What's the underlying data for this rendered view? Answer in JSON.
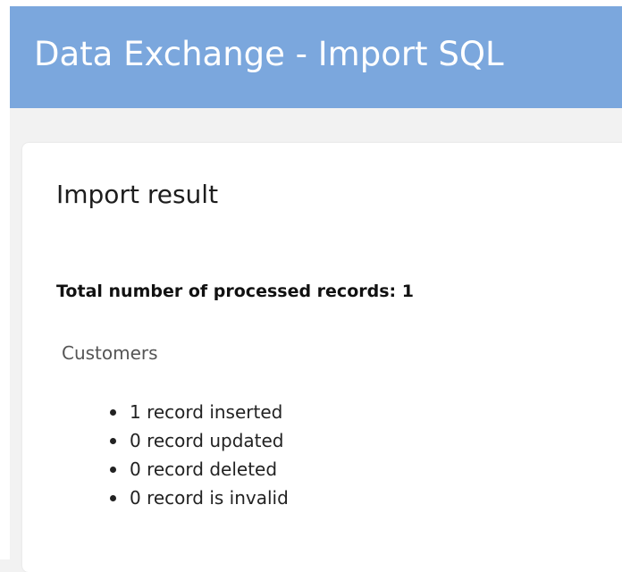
{
  "header": {
    "title": "Data Exchange - Import SQL"
  },
  "card": {
    "title": "Import result",
    "summary": "Total number of processed records: 1",
    "entity": "Customers",
    "results": [
      "1 record inserted",
      "0 record updated",
      "0 record deleted",
      "0 record is invalid"
    ]
  },
  "colors": {
    "header_bg": "#7ba7dd",
    "page_bg": "#f2f2f2",
    "card_bg": "#ffffff"
  }
}
